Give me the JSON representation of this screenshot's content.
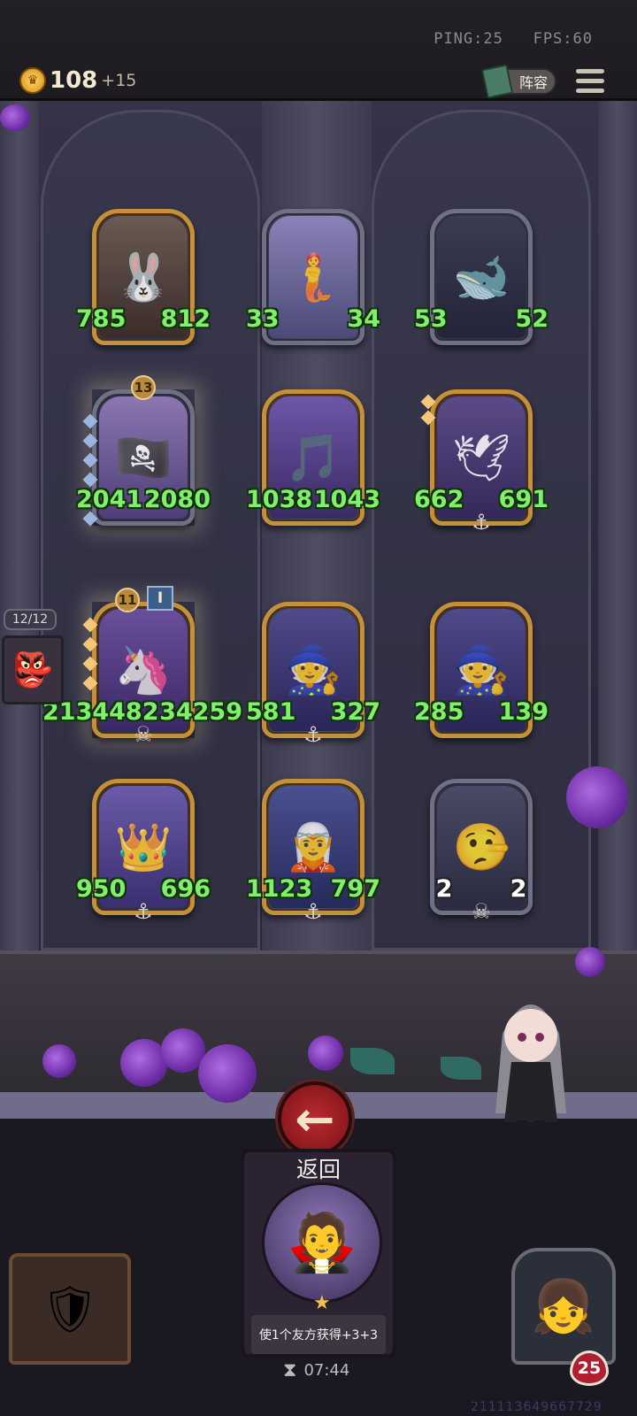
{
  "status": {
    "ping": "PING:25",
    "fps": "FPS:60"
  },
  "resources": {
    "gold": "108",
    "gold_income": "+15"
  },
  "header": {
    "lineup_label": "阵容"
  },
  "queue": {
    "count": "12/12",
    "card_icon": "goblin-portrait"
  },
  "board": {
    "row1": [
      {
        "name": "rabbit-mask-brute",
        "atk": "785",
        "hp": "812",
        "frame": "gold",
        "icon": "🐰"
      },
      {
        "name": "sea-princess",
        "atk": "33",
        "hp": "34",
        "frame": "silver",
        "icon": "🧜"
      },
      {
        "name": "singing-whale",
        "atk": "53",
        "hp": "52",
        "frame": "silver",
        "icon": "🐋"
      }
    ],
    "row2": [
      {
        "name": "pirate-captain",
        "atk": "2041",
        "hp": "2080",
        "frame": "silver",
        "icon": "🏴‍☠️",
        "level": "13"
      },
      {
        "name": "harp-maiden",
        "atk": "1038",
        "hp": "1043",
        "frame": "gold",
        "icon": "🎵"
      },
      {
        "name": "white-dove",
        "atk": "662",
        "hp": "691",
        "frame": "gold",
        "icon": "🕊"
      }
    ],
    "row3": [
      {
        "name": "golden-unicorn",
        "atk": "2134482",
        "hp": "34259",
        "frame": "gold",
        "icon": "🦄",
        "level": "11",
        "tier": "I"
      },
      {
        "name": "frost-sorcerer",
        "atk": "581",
        "hp": "327",
        "frame": "gold",
        "icon": "🧙"
      },
      {
        "name": "frost-sorcerer-2",
        "atk": "285",
        "hp": "139",
        "frame": "gold",
        "icon": "🧙"
      }
    ],
    "row4": [
      {
        "name": "sea-king",
        "atk": "950",
        "hp": "696",
        "frame": "gold",
        "icon": "👑"
      },
      {
        "name": "storm-witch",
        "atk": "1123",
        "hp": "797",
        "frame": "gold",
        "icon": "🧝"
      },
      {
        "name": "puppet-boy",
        "atk": "2",
        "hp": "2",
        "frame": "silver",
        "icon": "🤥"
      }
    ]
  },
  "hero": {
    "back_label": "返回",
    "description": "使1个友方获得+3+3",
    "timer": "07:44"
  },
  "player": {
    "health": "25",
    "id": "211113649667729"
  },
  "colors": {
    "stat_green": "#7ff06a",
    "gold_frame": "#c4913a",
    "back_red": "#b82a30"
  }
}
